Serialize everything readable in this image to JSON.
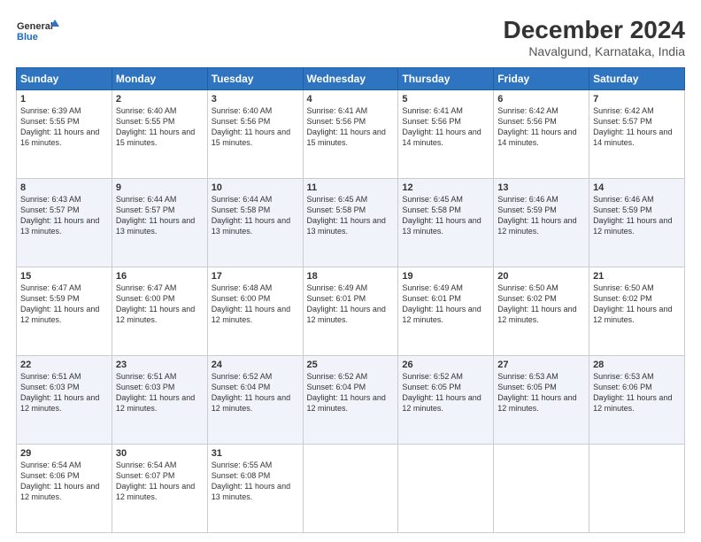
{
  "header": {
    "logo_line1": "General",
    "logo_line2": "Blue",
    "main_title": "December 2024",
    "sub_title": "Navalgund, Karnataka, India"
  },
  "days_of_week": [
    "Sunday",
    "Monday",
    "Tuesday",
    "Wednesday",
    "Thursday",
    "Friday",
    "Saturday"
  ],
  "weeks": [
    [
      {
        "day": 1,
        "sunrise": "6:39 AM",
        "sunset": "5:55 PM",
        "daylight": "11 hours and 16 minutes."
      },
      {
        "day": 2,
        "sunrise": "6:40 AM",
        "sunset": "5:55 PM",
        "daylight": "11 hours and 15 minutes."
      },
      {
        "day": 3,
        "sunrise": "6:40 AM",
        "sunset": "5:56 PM",
        "daylight": "11 hours and 15 minutes."
      },
      {
        "day": 4,
        "sunrise": "6:41 AM",
        "sunset": "5:56 PM",
        "daylight": "11 hours and 15 minutes."
      },
      {
        "day": 5,
        "sunrise": "6:41 AM",
        "sunset": "5:56 PM",
        "daylight": "11 hours and 14 minutes."
      },
      {
        "day": 6,
        "sunrise": "6:42 AM",
        "sunset": "5:56 PM",
        "daylight": "11 hours and 14 minutes."
      },
      {
        "day": 7,
        "sunrise": "6:42 AM",
        "sunset": "5:57 PM",
        "daylight": "11 hours and 14 minutes."
      }
    ],
    [
      {
        "day": 8,
        "sunrise": "6:43 AM",
        "sunset": "5:57 PM",
        "daylight": "11 hours and 13 minutes."
      },
      {
        "day": 9,
        "sunrise": "6:44 AM",
        "sunset": "5:57 PM",
        "daylight": "11 hours and 13 minutes."
      },
      {
        "day": 10,
        "sunrise": "6:44 AM",
        "sunset": "5:58 PM",
        "daylight": "11 hours and 13 minutes."
      },
      {
        "day": 11,
        "sunrise": "6:45 AM",
        "sunset": "5:58 PM",
        "daylight": "11 hours and 13 minutes."
      },
      {
        "day": 12,
        "sunrise": "6:45 AM",
        "sunset": "5:58 PM",
        "daylight": "11 hours and 13 minutes."
      },
      {
        "day": 13,
        "sunrise": "6:46 AM",
        "sunset": "5:59 PM",
        "daylight": "11 hours and 12 minutes."
      },
      {
        "day": 14,
        "sunrise": "6:46 AM",
        "sunset": "5:59 PM",
        "daylight": "11 hours and 12 minutes."
      }
    ],
    [
      {
        "day": 15,
        "sunrise": "6:47 AM",
        "sunset": "5:59 PM",
        "daylight": "11 hours and 12 minutes."
      },
      {
        "day": 16,
        "sunrise": "6:47 AM",
        "sunset": "6:00 PM",
        "daylight": "11 hours and 12 minutes."
      },
      {
        "day": 17,
        "sunrise": "6:48 AM",
        "sunset": "6:00 PM",
        "daylight": "11 hours and 12 minutes."
      },
      {
        "day": 18,
        "sunrise": "6:49 AM",
        "sunset": "6:01 PM",
        "daylight": "11 hours and 12 minutes."
      },
      {
        "day": 19,
        "sunrise": "6:49 AM",
        "sunset": "6:01 PM",
        "daylight": "11 hours and 12 minutes."
      },
      {
        "day": 20,
        "sunrise": "6:50 AM",
        "sunset": "6:02 PM",
        "daylight": "11 hours and 12 minutes."
      },
      {
        "day": 21,
        "sunrise": "6:50 AM",
        "sunset": "6:02 PM",
        "daylight": "11 hours and 12 minutes."
      }
    ],
    [
      {
        "day": 22,
        "sunrise": "6:51 AM",
        "sunset": "6:03 PM",
        "daylight": "11 hours and 12 minutes."
      },
      {
        "day": 23,
        "sunrise": "6:51 AM",
        "sunset": "6:03 PM",
        "daylight": "11 hours and 12 minutes."
      },
      {
        "day": 24,
        "sunrise": "6:52 AM",
        "sunset": "6:04 PM",
        "daylight": "11 hours and 12 minutes."
      },
      {
        "day": 25,
        "sunrise": "6:52 AM",
        "sunset": "6:04 PM",
        "daylight": "11 hours and 12 minutes."
      },
      {
        "day": 26,
        "sunrise": "6:52 AM",
        "sunset": "6:05 PM",
        "daylight": "11 hours and 12 minutes."
      },
      {
        "day": 27,
        "sunrise": "6:53 AM",
        "sunset": "6:05 PM",
        "daylight": "11 hours and 12 minutes."
      },
      {
        "day": 28,
        "sunrise": "6:53 AM",
        "sunset": "6:06 PM",
        "daylight": "11 hours and 12 minutes."
      }
    ],
    [
      {
        "day": 29,
        "sunrise": "6:54 AM",
        "sunset": "6:06 PM",
        "daylight": "11 hours and 12 minutes."
      },
      {
        "day": 30,
        "sunrise": "6:54 AM",
        "sunset": "6:07 PM",
        "daylight": "11 hours and 12 minutes."
      },
      {
        "day": 31,
        "sunrise": "6:55 AM",
        "sunset": "6:08 PM",
        "daylight": "11 hours and 13 minutes."
      },
      null,
      null,
      null,
      null
    ]
  ]
}
